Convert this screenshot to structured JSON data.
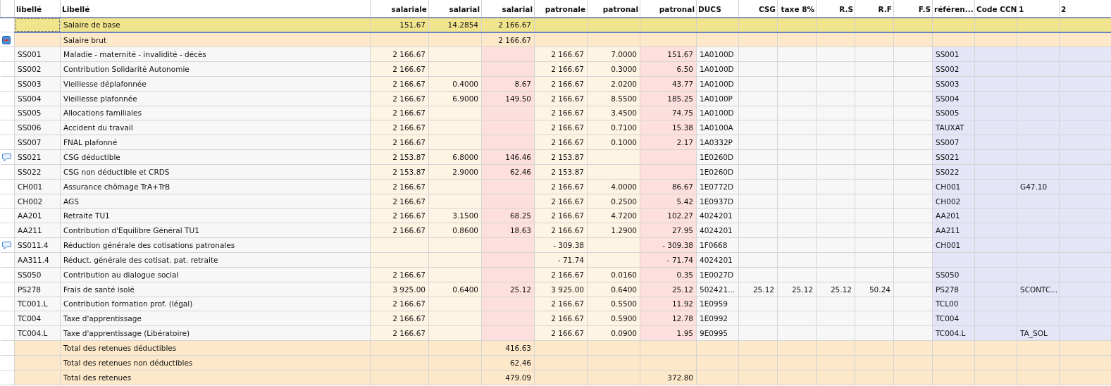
{
  "table": {
    "columns": [
      "libellé",
      "Libellé",
      "salariale",
      "salarial",
      "salarial",
      "patronale",
      "patronal",
      "patronal",
      "DUCS",
      "CSG",
      "taxe 8%",
      "R.S",
      "R.F",
      "F.S",
      "référen...",
      "Code CCN",
      "1",
      "2"
    ],
    "rows": [
      {
        "kind": "base",
        "comment": false,
        "selected": true,
        "cells": [
          null,
          "Salaire de base",
          "151.67",
          "14.2854",
          "2 166.67"
        ]
      },
      {
        "kind": "group",
        "comment": false,
        "expanded": true,
        "selected": false,
        "cells": [
          null,
          "Salaire brut",
          null,
          null,
          "2 166.67"
        ]
      },
      {
        "kind": "line",
        "comment": false,
        "selected": false,
        "cells": [
          "SS001",
          "Maladie - maternité - invalidité - décès",
          "2 166.67",
          null,
          null,
          "2 166.67",
          "7.0000",
          "151.67",
          "1A0100D",
          null,
          null,
          null,
          null,
          null,
          "SS001"
        ]
      },
      {
        "kind": "line",
        "comment": false,
        "selected": false,
        "cells": [
          "SS002",
          "Contribution Solidarité Autonomie",
          "2 166.67",
          null,
          null,
          "2 166.67",
          "0.3000",
          "6.50",
          "1A0100D",
          null,
          null,
          null,
          null,
          null,
          "SS002"
        ]
      },
      {
        "kind": "line",
        "comment": false,
        "selected": false,
        "cells": [
          "SS003",
          "Vieillesse déplafonnée",
          "2 166.67",
          "0.4000",
          "8.67",
          "2 166.67",
          "2.0200",
          "43.77",
          "1A0100D",
          null,
          null,
          null,
          null,
          null,
          "SS003"
        ]
      },
      {
        "kind": "line",
        "comment": false,
        "selected": false,
        "cells": [
          "SS004",
          "Vieillesse plafonnée",
          "2 166.67",
          "6.9000",
          "149.50",
          "2 166.67",
          "8.5500",
          "185.25",
          "1A0100P",
          null,
          null,
          null,
          null,
          null,
          "SS004"
        ]
      },
      {
        "kind": "line",
        "comment": false,
        "selected": false,
        "cells": [
          "SS005",
          "Allocations familiales",
          "2 166.67",
          null,
          null,
          "2 166.67",
          "3.4500",
          "74.75",
          "1A0100D",
          null,
          null,
          null,
          null,
          null,
          "SS005"
        ]
      },
      {
        "kind": "line",
        "comment": false,
        "selected": false,
        "cells": [
          "SS006",
          "Accident du travail",
          "2 166.67",
          null,
          null,
          "2 166.67",
          "0.7100",
          "15.38",
          "1A0100A",
          null,
          null,
          null,
          null,
          null,
          "TAUXAT"
        ]
      },
      {
        "kind": "line",
        "comment": false,
        "selected": false,
        "cells": [
          "SS007",
          "FNAL plafonné",
          "2 166.67",
          null,
          null,
          "2 166.67",
          "0.1000",
          "2.17",
          "1A0332P",
          null,
          null,
          null,
          null,
          null,
          "SS007"
        ]
      },
      {
        "kind": "line",
        "comment": true,
        "selected": false,
        "cells": [
          "SS021",
          "CSG déductible",
          "2 153.87",
          "6.8000",
          "146.46",
          "2 153.87",
          null,
          null,
          "1E0260D",
          null,
          null,
          null,
          null,
          null,
          "SS021"
        ]
      },
      {
        "kind": "line",
        "comment": false,
        "selected": false,
        "cells": [
          "SS022",
          "CSG non déductible et CRDS",
          "2 153.87",
          "2.9000",
          "62.46",
          "2 153.87",
          null,
          null,
          "1E0260D",
          null,
          null,
          null,
          null,
          null,
          "SS022"
        ]
      },
      {
        "kind": "line",
        "comment": false,
        "selected": false,
        "cells": [
          "CH001",
          "Assurance chômage TrA+TrB",
          "2 166.67",
          null,
          null,
          "2 166.67",
          "4.0000",
          "86.67",
          "1E0772D",
          null,
          null,
          null,
          null,
          null,
          "CH001",
          null,
          "G47.10"
        ]
      },
      {
        "kind": "line",
        "comment": false,
        "selected": false,
        "cells": [
          "CH002",
          "AGS",
          "2 166.67",
          null,
          null,
          "2 166.67",
          "0.2500",
          "5.42",
          "1E0937D",
          null,
          null,
          null,
          null,
          null,
          "CH002"
        ]
      },
      {
        "kind": "line",
        "comment": false,
        "selected": false,
        "cells": [
          "AA201",
          "Retraite TU1",
          "2 166.67",
          "3.1500",
          "68.25",
          "2 166.67",
          "4.7200",
          "102.27",
          "4024201",
          null,
          null,
          null,
          null,
          null,
          "AA201"
        ]
      },
      {
        "kind": "line",
        "comment": false,
        "selected": false,
        "cells": [
          "AA211",
          "Contribution d'Equilibre Général TU1",
          "2 166.67",
          "0.8600",
          "18.63",
          "2 166.67",
          "1.2900",
          "27.95",
          "4024201",
          null,
          null,
          null,
          null,
          null,
          "AA211"
        ]
      },
      {
        "kind": "line",
        "comment": true,
        "selected": false,
        "cells": [
          "SS011.4",
          "Réduction générale des cotisations patronales",
          null,
          null,
          null,
          "- 309.38",
          null,
          "- 309.38",
          "1F0668",
          null,
          null,
          null,
          null,
          null,
          "CH001"
        ]
      },
      {
        "kind": "line",
        "comment": false,
        "selected": false,
        "cells": [
          "AA311.4",
          "Réduct. générale des cotisat. pat. retraite",
          null,
          null,
          null,
          "- 71.74",
          null,
          "- 71.74",
          "4024201"
        ]
      },
      {
        "kind": "line",
        "comment": false,
        "selected": false,
        "cells": [
          "SS050",
          "Contribution au dialogue social",
          "2 166.67",
          null,
          null,
          "2 166.67",
          "0.0160",
          "0.35",
          "1E0027D",
          null,
          null,
          null,
          null,
          null,
          "SS050"
        ]
      },
      {
        "kind": "line",
        "comment": false,
        "selected": false,
        "cells": [
          "PS278",
          "Frais de santé isolé",
          "3 925.00",
          "0.6400",
          "25.12",
          "3 925.00",
          "0.6400",
          "25.12",
          "502421...",
          "25.12",
          "25.12",
          "25.12",
          "50.24",
          null,
          "PS278",
          null,
          "SCONTC..."
        ]
      },
      {
        "kind": "line",
        "comment": false,
        "selected": false,
        "cells": [
          "TC001.L",
          "Contribution formation prof. (légal)",
          "2 166.67",
          null,
          null,
          "2 166.67",
          "0.5500",
          "11.92",
          "1E0959",
          null,
          null,
          null,
          null,
          null,
          "TCL00"
        ]
      },
      {
        "kind": "line",
        "comment": false,
        "selected": false,
        "cells": [
          "TC004",
          "Taxe d'apprentissage",
          "2 166.67",
          null,
          null,
          "2 166.67",
          "0.5900",
          "12.78",
          "1E0992",
          null,
          null,
          null,
          null,
          null,
          "TC004"
        ]
      },
      {
        "kind": "line",
        "comment": false,
        "selected": false,
        "cells": [
          "TC004.L",
          "Taxe d'apprentissage (Libératoire)",
          "2 166.67",
          null,
          null,
          "2 166.67",
          "0.0900",
          "1.95",
          "9E0995",
          null,
          null,
          null,
          null,
          null,
          "TC004.L",
          null,
          "TA_SOL"
        ]
      },
      {
        "kind": "total",
        "comment": false,
        "selected": false,
        "cells": [
          null,
          "Total des retenues déductibles",
          null,
          null,
          "416.63"
        ]
      },
      {
        "kind": "total",
        "comment": false,
        "selected": false,
        "cells": [
          null,
          "Total des retenues non déductibles",
          null,
          null,
          "62.46"
        ]
      },
      {
        "kind": "total",
        "comment": false,
        "selected": false,
        "cells": [
          null,
          "Total des retenues",
          null,
          null,
          "479.09",
          null,
          null,
          "372.80"
        ]
      }
    ]
  }
}
